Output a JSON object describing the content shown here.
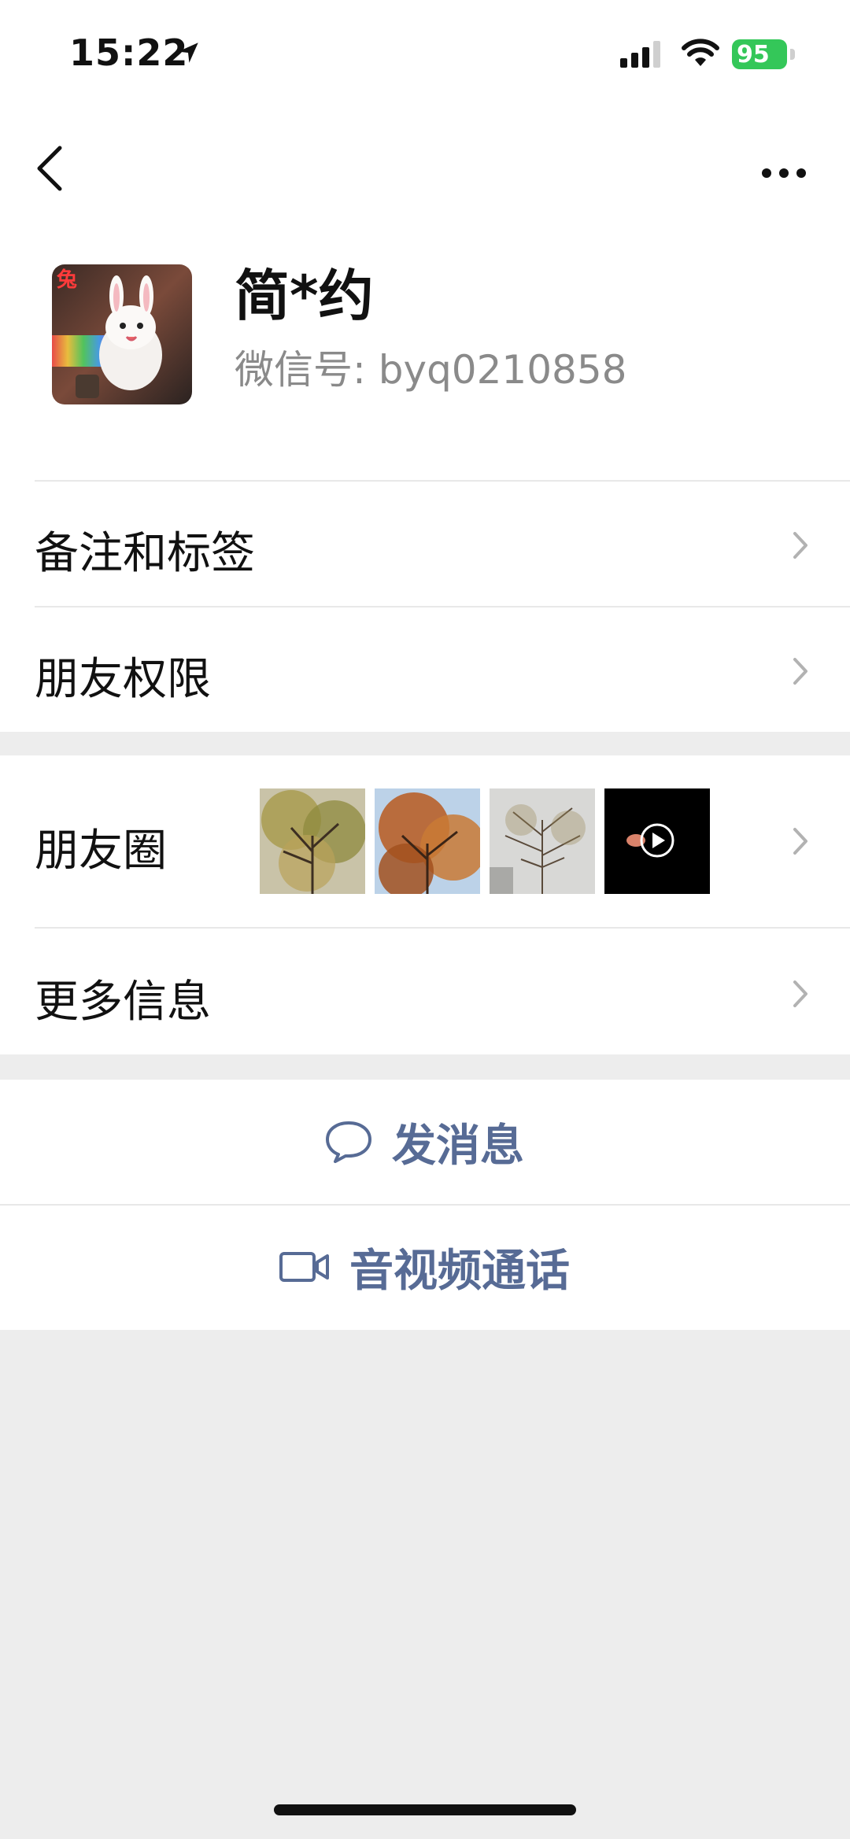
{
  "status_bar": {
    "time": "15:22",
    "battery": "95"
  },
  "profile": {
    "name": "简*约",
    "wechat_id": "微信号: byq0210858"
  },
  "menu": {
    "remark_tags": "备注和标签",
    "friend_permissions": "朋友权限",
    "moments": "朋友圈",
    "more_info": "更多信息"
  },
  "actions": {
    "send_message": "发消息",
    "video_call": "音视频通话"
  },
  "colors": {
    "link": "#576b95",
    "background": "#ededed",
    "battery": "#34c759"
  }
}
